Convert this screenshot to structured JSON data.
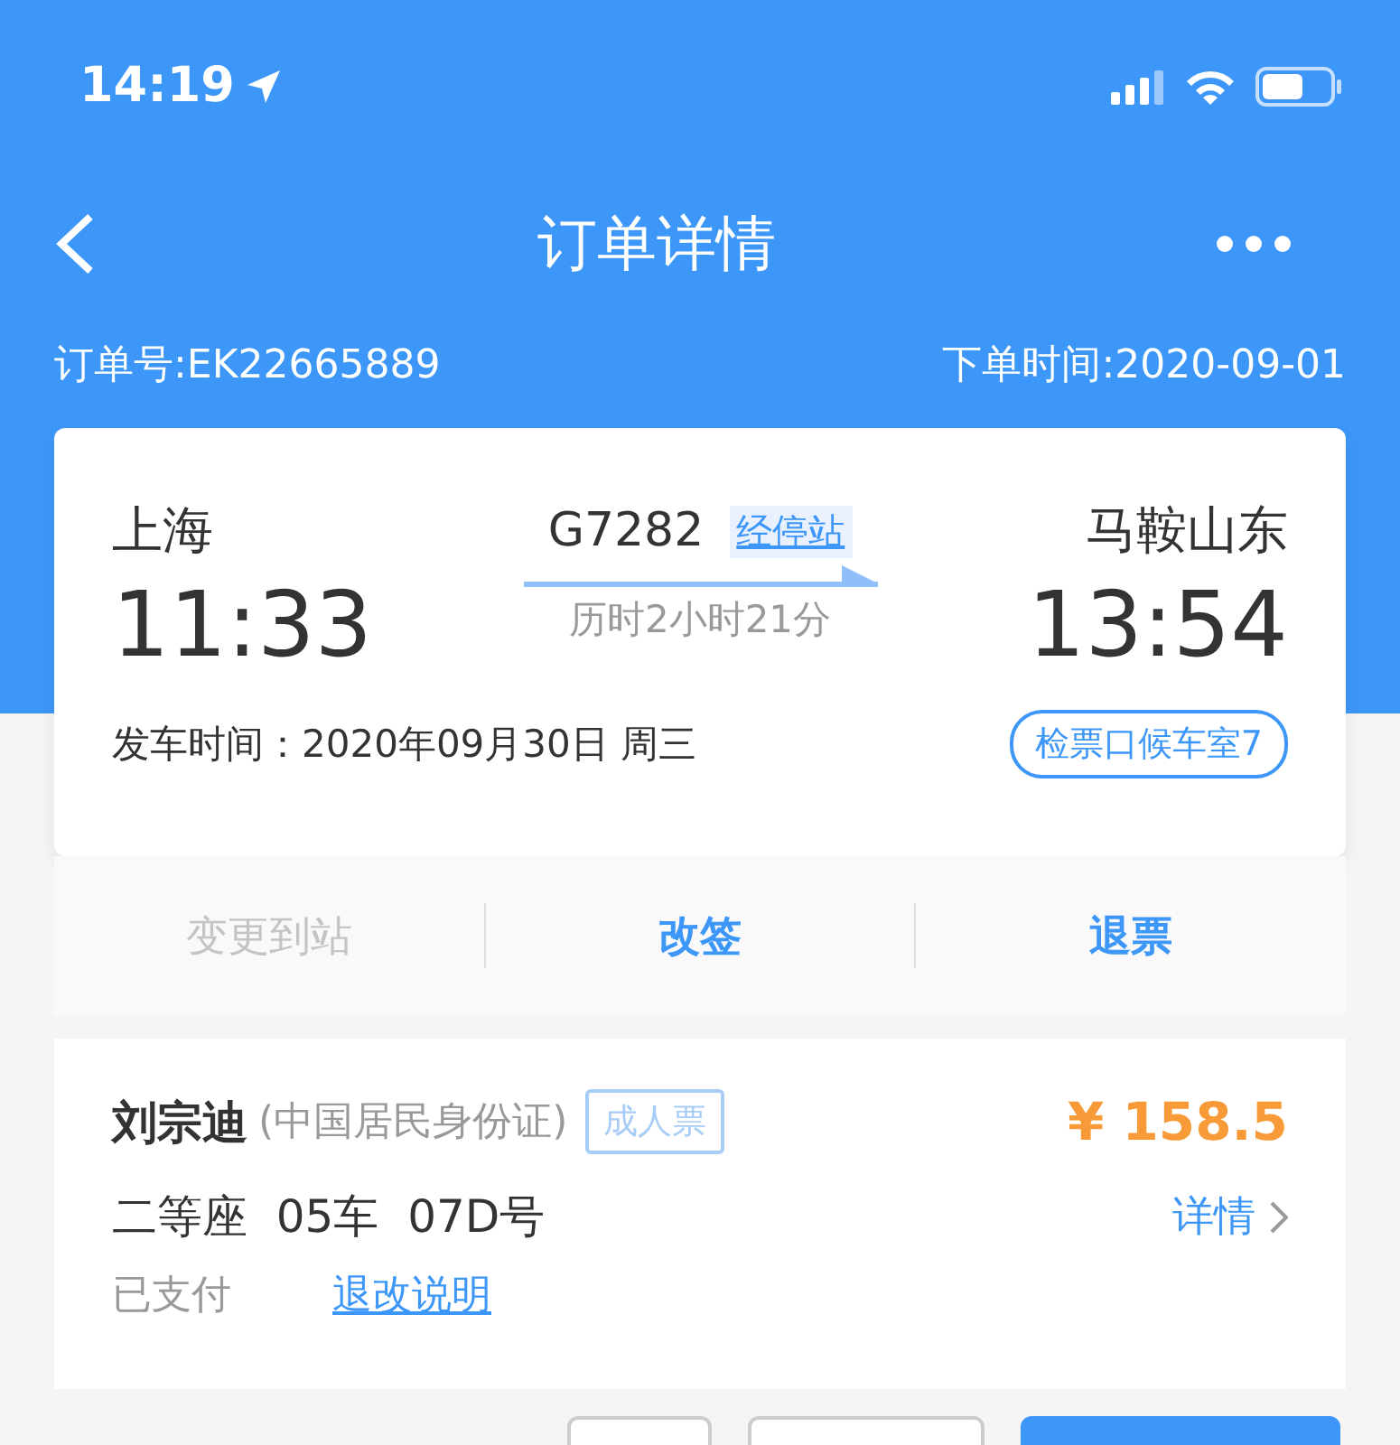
{
  "status_bar": {
    "time": "14:19"
  },
  "nav": {
    "title": "订单详情"
  },
  "order": {
    "number": "订单号:EK22665889",
    "date": "下单时间:2020-09-01"
  },
  "trip": {
    "from_station": "上海",
    "from_time": "11:33",
    "train": "G7282",
    "stops_link": "经停站",
    "duration": "历时2小时21分",
    "to_station": "马鞍山东",
    "to_time": "13:54",
    "departure": "发车时间：2020年09月30日 周三",
    "gate": "检票口候车室7"
  },
  "actions": [
    {
      "label": "变更到站",
      "disabled": true
    },
    {
      "label": "改签",
      "disabled": false
    },
    {
      "label": "退票",
      "disabled": false
    }
  ],
  "passenger": {
    "name": "刘宗迪",
    "id_type": "(中国居民身份证)",
    "ticket_type": "成人票",
    "price": "¥ 158.5",
    "seat": "二等座  05车  07D号",
    "details": "详情",
    "status": "已支付",
    "rules_link": "退改说明"
  },
  "bottom_buttons": [
    {
      "kind": "outline"
    },
    {
      "kind": "outline"
    },
    {
      "kind": "primary"
    }
  ]
}
